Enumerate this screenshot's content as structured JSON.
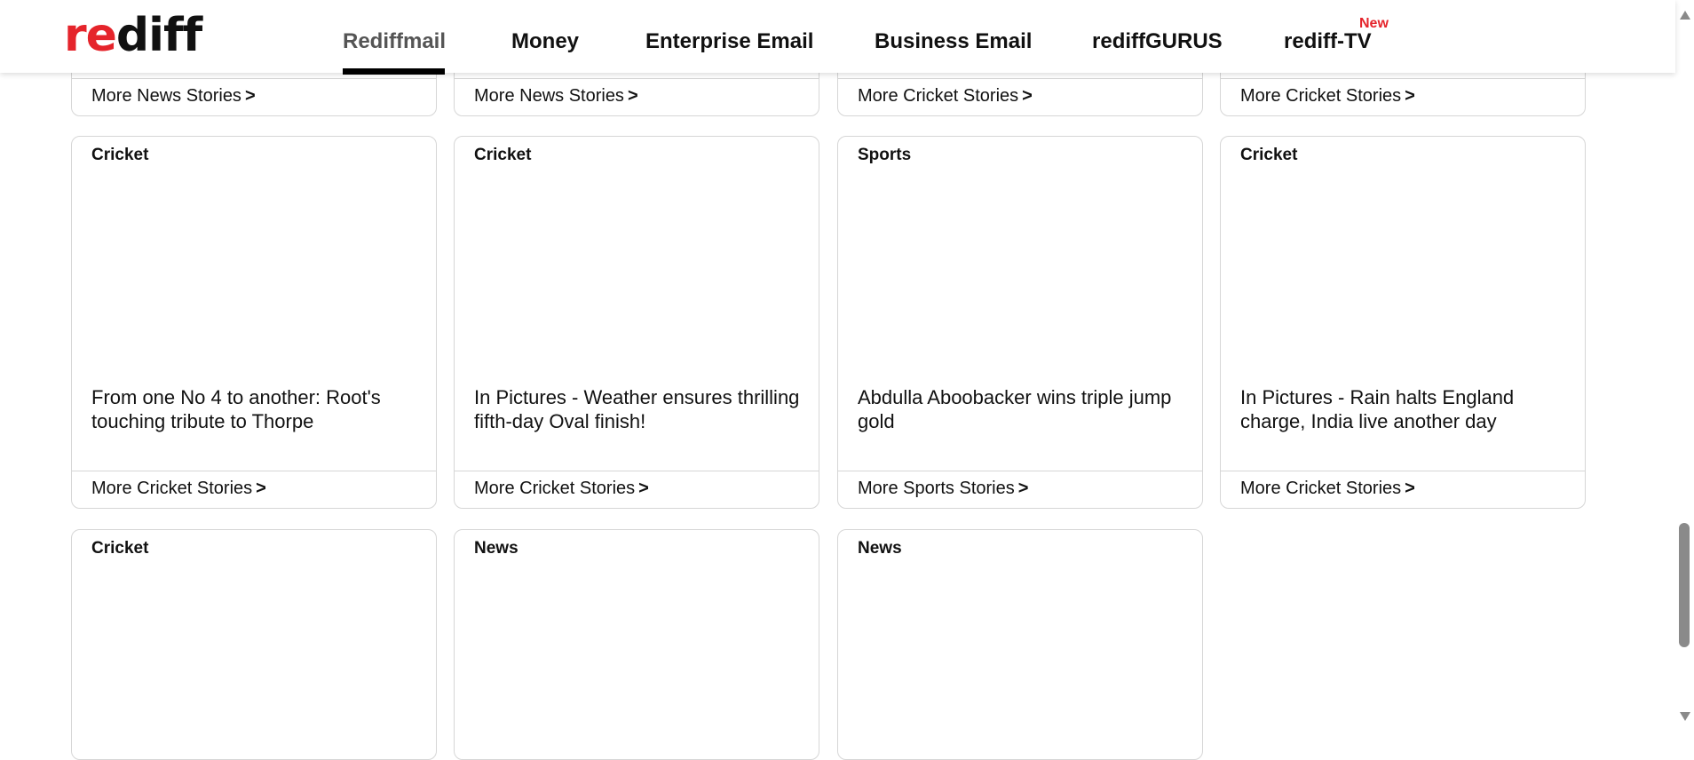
{
  "logo": {
    "part_red": "re",
    "part_black": "diff"
  },
  "nav": {
    "items": [
      {
        "label": "Rediffmail"
      },
      {
        "label": "Money"
      },
      {
        "label": "Enterprise Email"
      },
      {
        "label": "Business Email"
      },
      {
        "label": "rediffGURUS"
      },
      {
        "label": "rediff-TV"
      }
    ],
    "new_badge": "New"
  },
  "arrow": ">",
  "top_row_links": [
    "More News Stories",
    "More News Stories",
    "More Cricket Stories",
    "More Cricket Stories"
  ],
  "row2": [
    {
      "category": "Cricket",
      "title": "From one No 4 to another: Root's touching tribute to Thorpe",
      "more": "More Cricket Stories"
    },
    {
      "category": "Cricket",
      "title": "In Pictures - Weather ensures thrilling fifth-day Oval finish!",
      "more": "More Cricket Stories"
    },
    {
      "category": "Sports",
      "title": "Abdulla Aboobacker wins triple jump gold",
      "more": "More Sports Stories"
    },
    {
      "category": "Cricket",
      "title": "In Pictures - Rain halts England charge, India live another day",
      "more": "More Cricket Stories"
    }
  ],
  "row3": [
    {
      "category": "Cricket"
    },
    {
      "category": "News"
    },
    {
      "category": "News"
    }
  ],
  "colors": {
    "brand_red": "#e5242b",
    "border": "#d6d6d6",
    "text": "#111111"
  }
}
